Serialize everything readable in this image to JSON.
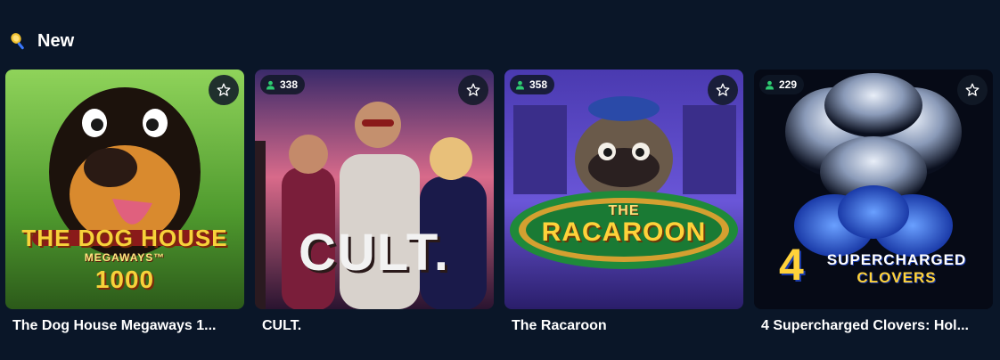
{
  "section": {
    "title": "New",
    "icon": "racket-icon"
  },
  "games": [
    {
      "title": "The Dog House Megaways 1...",
      "players": null,
      "logo": [
        "THE DOG HOUSE",
        "MEGAWAYS™",
        "1000"
      ],
      "palette": [
        "#7cc24a",
        "#f4b23c",
        "#2a1a10"
      ]
    },
    {
      "title": "CULT.",
      "players": "338",
      "logo": [
        "CULT."
      ],
      "palette": [
        "#c8557a",
        "#6a2a6a",
        "#1c1030"
      ]
    },
    {
      "title": "The Racaroon",
      "players": "358",
      "logo": [
        "THE",
        "RACAROON"
      ],
      "palette": [
        "#6c4ad8",
        "#3b2a8a",
        "#1a7a3a"
      ]
    },
    {
      "title": "4 Supercharged Clovers: Hol...",
      "players": "229",
      "logo": [
        "4",
        "SUPERCHARGED",
        "CLOVERS"
      ],
      "palette": [
        "#0a0f1e",
        "#2f6cff",
        "#ffd23a"
      ]
    }
  ],
  "colors": {
    "background": "#0a1628",
    "player_icon": "#2ecc71",
    "text": "#ffffff"
  },
  "icons": {
    "favorite": "star-outline-icon",
    "players": "user-icon"
  }
}
